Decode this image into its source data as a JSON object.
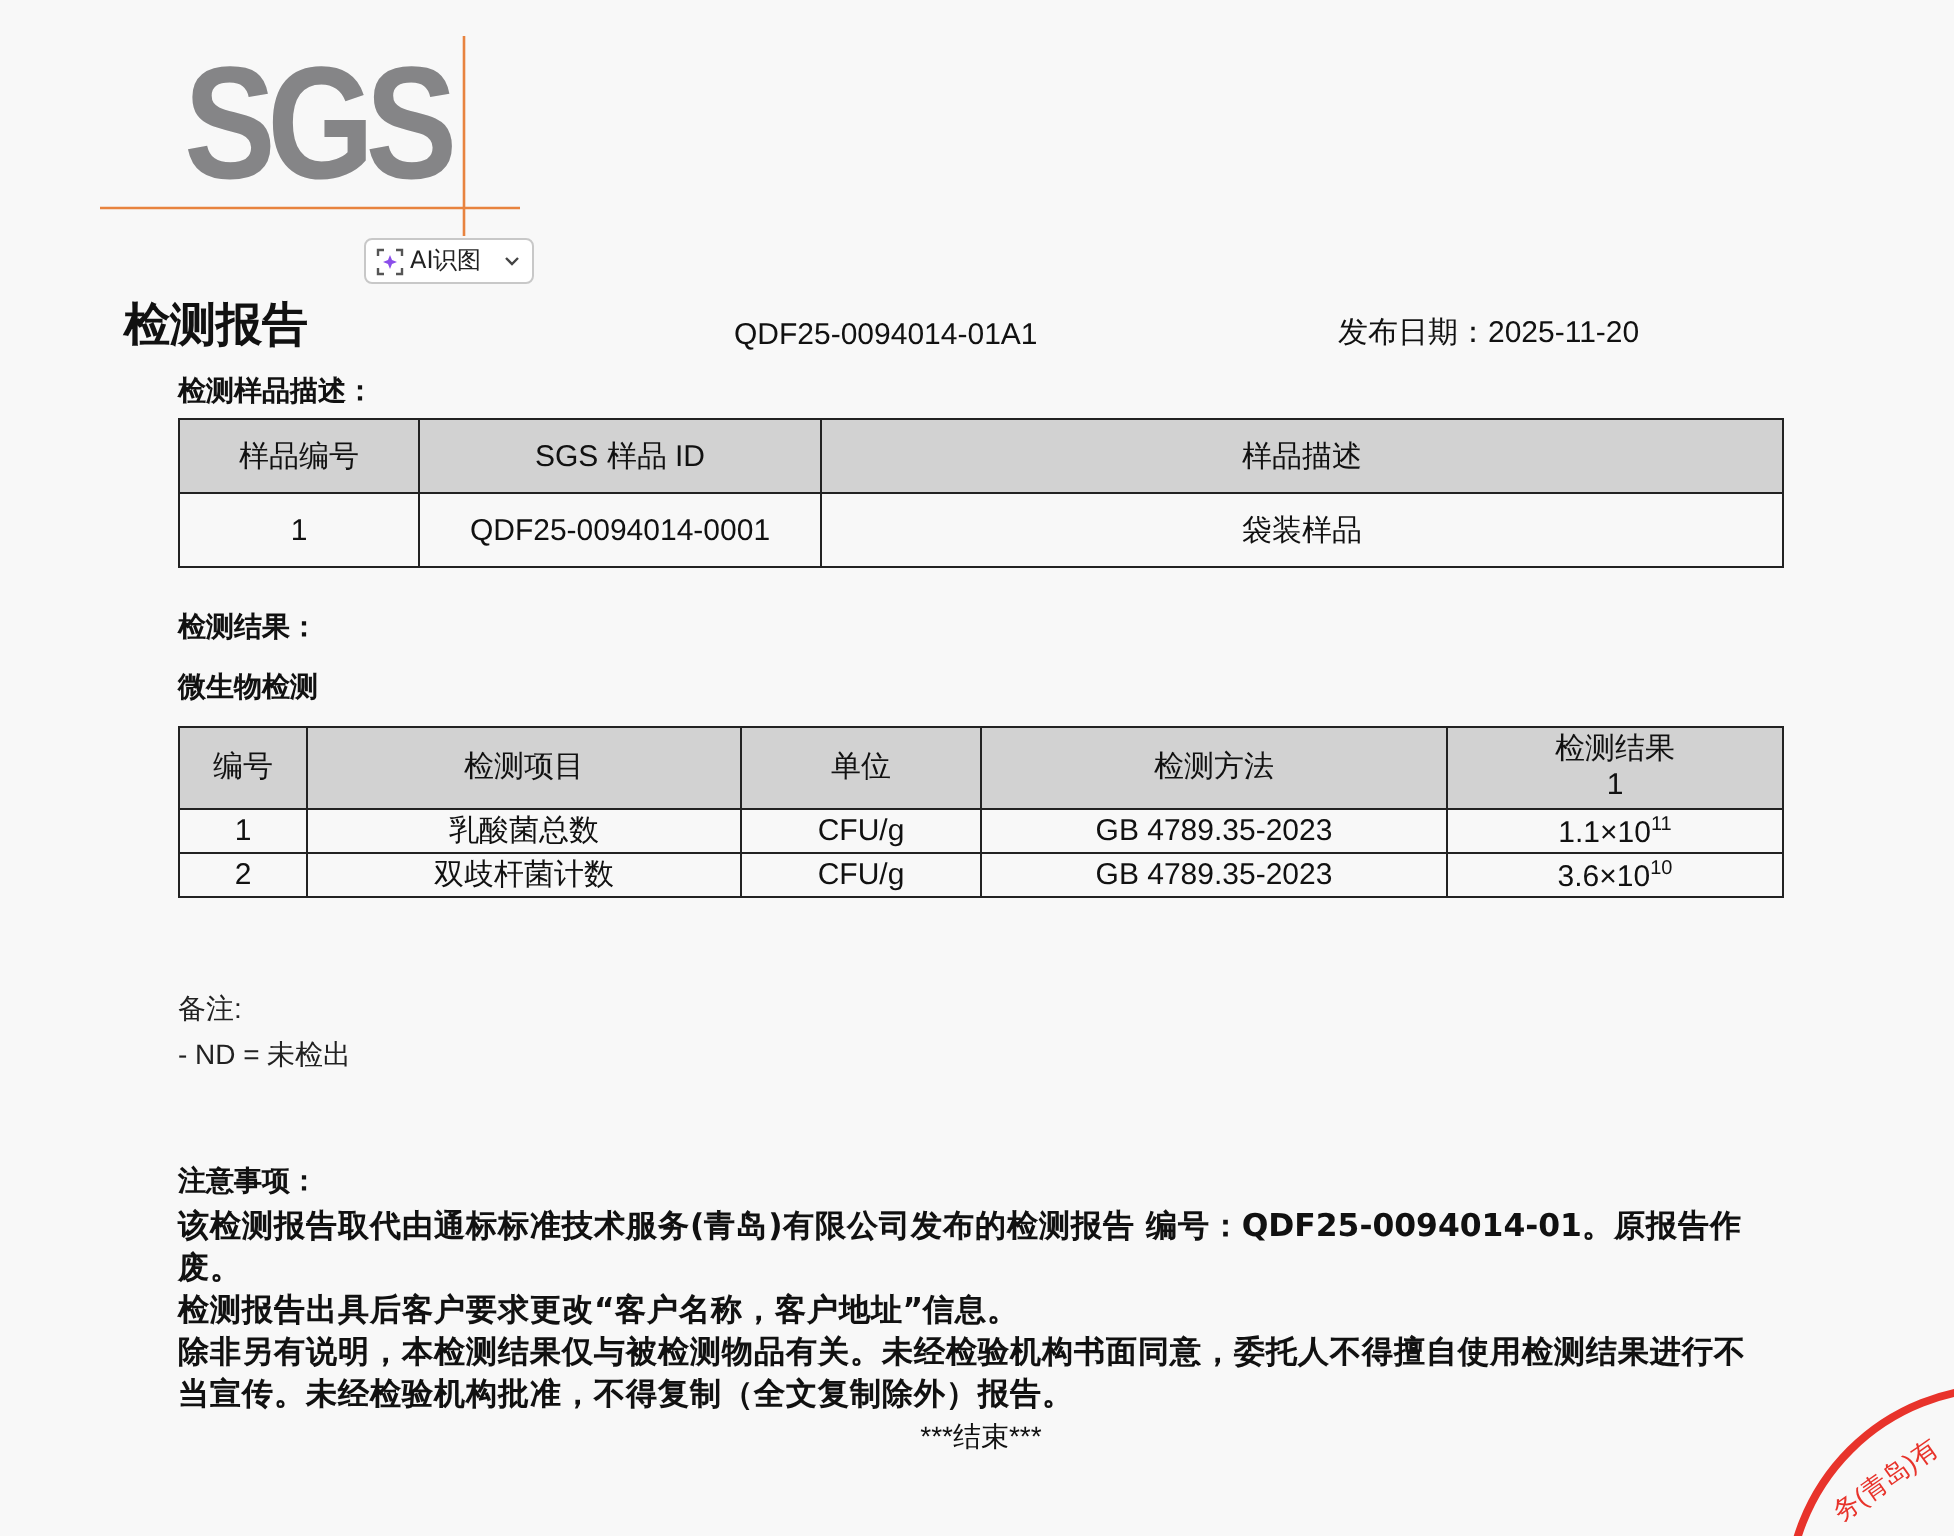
{
  "logo": "SGS",
  "ai_button": {
    "label": "AI识图"
  },
  "header": {
    "title": "检测报告",
    "report_no": "QDF25-0094014-01A1",
    "date": "发布日期：2025-11-20"
  },
  "sample_section": {
    "heading": "检测样品描述：",
    "columns": [
      "样品编号",
      "SGS 样品 ID",
      "样品描述"
    ],
    "rows": [
      [
        "1",
        "QDF25-0094014-0001",
        "袋装样品"
      ]
    ]
  },
  "results_heading": "检测结果：",
  "results_section": {
    "heading": "微生物检测",
    "columns": [
      "编号",
      "检测项目",
      "单位",
      "检测方法",
      "检测结果\n1"
    ],
    "rows": [
      [
        "1",
        "乳酸菌总数",
        "CFU/g",
        "GB 4789.35-2023",
        "1.1×10$^{11}$"
      ],
      [
        "2",
        "双歧杆菌计数",
        "CFU/g",
        "GB 4789.35-2023",
        "3.6×10$^{10}$"
      ]
    ]
  },
  "remarks": {
    "heading": "备注:",
    "lines": [
      "- ND = 未检出"
    ]
  },
  "notices": {
    "heading": "注意事项：",
    "paragraphs": [
      "该检测报告取代由通标标准技术服务(青岛)有限公司发布的检测报告 编号：**QDF25-0094014-01**。原报告作废。",
      "检测报告出具后客户要求更改“客户名称，客户地址”信息。",
      "除非另有说明，本检测结果仅与被检测物品有关。未经检验机构书面同意，委托人不得擅自使用检测结果进行不当宣传。未经检验机构批准，不得复制（全文复制除外）报告。"
    ]
  },
  "end_mark": "***结束***",
  "seal": {
    "text": "务(青岛)有"
  }
}
